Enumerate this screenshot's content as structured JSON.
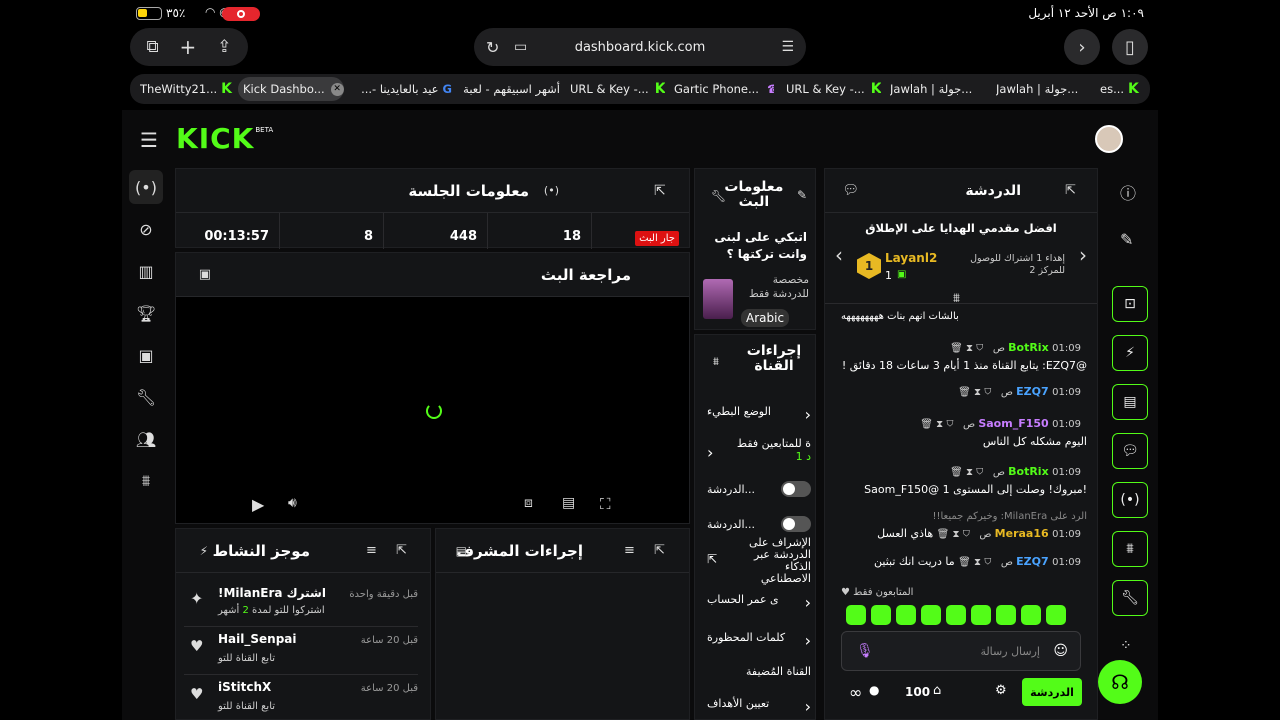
{
  "status_bar": {
    "time": "١:٠٩ ص   الأحد ١٢ أبريل",
    "battery": "٣٥٪"
  },
  "browser": {
    "url": "dashboard.kick.com"
  },
  "tabs": [
    {
      "label": "TheWitty21..."
    },
    {
      "label": "Kick Dashbo..."
    },
    {
      "label": "عيد بالعايدينا -..."
    },
    {
      "label": "أشهر اسبيقهم - لعبة تـ..."
    },
    {
      "label": "URL & Key -..."
    },
    {
      "label": "Gartic Phone..."
    },
    {
      "label": "URL & Key -..."
    },
    {
      "label": "Jawlah | جولة..."
    },
    {
      "label": "Jawlah | جولة..."
    },
    {
      "label": "es..."
    }
  ],
  "header": {
    "logo": "KICK",
    "logo_badge": "BETA"
  },
  "session": {
    "title": "معلومات الجلسة",
    "live_badge": "جار البث",
    "stat1": "18",
    "stat2": "448",
    "stat3": "8",
    "stat4": "00:13:57"
  },
  "review": {
    "title": "مراجعة البث"
  },
  "stream_info": {
    "title": "معلومات البث",
    "stream_title": "اتبكي على لبنى وانت تركتها ؟",
    "category": "مخصصة للدردشة فقط",
    "language": "Arabic"
  },
  "channel_actions": {
    "title": "إجراءات القناة",
    "items": [
      "الوضع البطيء",
      "ة للمتابعين فقط",
      "د 1",
      "...الدردشة",
      "...الدردشة",
      "الإشراف على الدردشة عبر الذكاء الاصطناعي",
      "ى عمر الحساب",
      "كلمات المحظورة",
      "القناة المُضيفة",
      "تعيين الأهداف"
    ]
  },
  "activity": {
    "title": "موجز النشاط",
    "items": [
      {
        "name": "!MilanEra اشترك",
        "sub_pre": "اشتركوا للتو لمدة",
        "sub_num": "2",
        "sub_post": "أشهر",
        "time": "قبل دقيقة واحدة"
      },
      {
        "name": "Hail_Senpai",
        "sub": "تابع القناة للتو",
        "time": "قبل 20 ساعة"
      },
      {
        "name": "iStitchX",
        "sub": "تابع القناة للتو",
        "time": "قبل 20 ساعة"
      }
    ]
  },
  "mod_actions": {
    "title": "إجراءات المشرف"
  },
  "chat": {
    "title": "الدردشة",
    "top_gifters": "افضل مقدمي الهدايا على الإطلاق",
    "gifter_name": "Layanl2",
    "gifter_count": "1",
    "gift_text": "إهداء 1 اشتراك للوصول للمركز 2",
    "pinned": "بالشات انهم بنات ههههههههه",
    "messages": [
      {
        "time": "01:09 ص",
        "user": "BotRix",
        "text": "@EZQ7: يتابع القناة منذ 1 أيام 3 ساعات 18 دقائق !"
      },
      {
        "time": "01:09 ص",
        "user": "EZQ7",
        "text": ""
      },
      {
        "time": "01:09 ص",
        "user": "Saom_F150",
        "text": "اليوم مشكله كل الناس"
      },
      {
        "time": "01:09 ص",
        "user": "BotRix",
        "text": "!مبروك! وصلت إلى المستوى 1 @Saom_F150"
      },
      {
        "time": "01:09 ص",
        "user": "Meraa16",
        "text": "هاذي العسل",
        "reply": "الرد على MilanEra: وخيركم جميعا!!"
      },
      {
        "time": "01:09 ص",
        "user": "EZQ7",
        "text": "ما دريت انك تبثين"
      }
    ],
    "followers_only": "المتابعون فقط",
    "input_placeholder": "إرسال رسالة",
    "points": "100",
    "send_label": "الدردشة"
  }
}
